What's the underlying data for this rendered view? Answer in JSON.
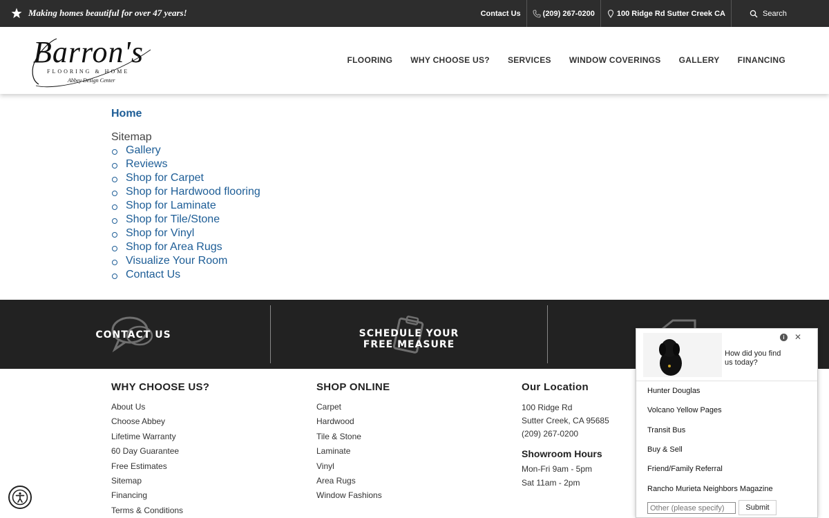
{
  "topbar": {
    "tagline": "Making homes beautiful for over 47 years!",
    "contact_label": "Contact Us",
    "phone": "(209) 267-0200",
    "address": "100 Ridge Rd Sutter Creek CA",
    "search_label": "Search"
  },
  "header": {
    "logo": {
      "script": "Barron's",
      "line1": "FLOORING & HOME",
      "line2": "Abbey Design Center"
    },
    "nav": [
      "FLOORING",
      "WHY CHOOSE US?",
      "SERVICES",
      "WINDOW COVERINGS",
      "GALLERY",
      "FINANCING"
    ]
  },
  "main": {
    "breadcrumb": "Home",
    "sitemap_title": "Sitemap",
    "sitemap_items": [
      "Gallery",
      "Reviews",
      "Shop for Carpet",
      "Shop for Hardwood flooring",
      "Shop for Laminate",
      "Shop for Tile/Stone",
      "Shop for Vinyl",
      "Shop for Area Rugs",
      "Visualize Your Room",
      "Contact Us"
    ]
  },
  "cta": {
    "contact": "CONTACT US",
    "schedule_line1": "SCHEDULE YOUR",
    "schedule_line2": "FREE MEASURE"
  },
  "footer": {
    "why": {
      "title": "WHY CHOOSE US?",
      "links": [
        "About Us",
        "Choose Abbey",
        "Lifetime Warranty",
        "60 Day Guarantee",
        "Free Estimates",
        "Sitemap",
        "Financing",
        "Terms & Conditions"
      ]
    },
    "shop": {
      "title": "SHOP ONLINE",
      "links": [
        "Carpet",
        "Hardwood",
        "Tile & Stone",
        "Laminate",
        "Vinyl",
        "Area Rugs",
        "Window Fashions"
      ]
    },
    "location": {
      "title": "Our Location",
      "street": "100 Ridge Rd",
      "city": "Sutter Creek, CA 95685",
      "phone": "(209) 267-0200",
      "hours_title": "Showroom Hours",
      "hours_weekday": "Mon-Fri 9am - 5pm",
      "hours_sat": "Sat 11am - 2pm"
    }
  },
  "survey": {
    "question": "How did you find us today?",
    "options": [
      "Hunter Douglas",
      "Volcano Yellow Pages",
      "Transit Bus",
      "Buy & Sell",
      "Friend/Family Referral",
      "Rancho Murieta Neighbors Magazine"
    ],
    "other_placeholder": "Other (please specify)",
    "submit_label": "Submit"
  },
  "colors": {
    "topbar": "#2d2d2d",
    "link": "#1d5d96",
    "cta_band": "#222222"
  }
}
